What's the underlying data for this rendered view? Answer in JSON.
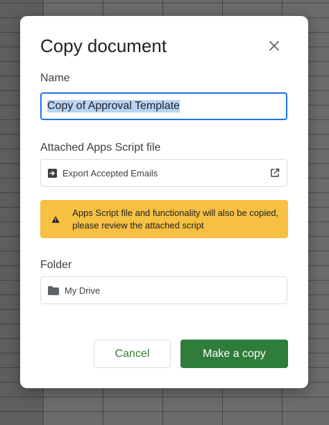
{
  "dialog": {
    "title": "Copy document",
    "close_icon": "close-icon",
    "name_label": "Name",
    "name_value": "Copy of Approval Template",
    "script_label": "Attached Apps Script file",
    "script_file": "Export Accepted Emails",
    "script_file_icon": "script-arrow-icon",
    "open_icon": "open-in-new-icon",
    "warning_text": "Apps Script file and functionality will also be copied, please review the attached script",
    "warning_icon": "warning-triangle-icon",
    "folder_label": "Folder",
    "folder_value": "My Drive",
    "folder_icon": "folder-icon",
    "cancel_label": "Cancel",
    "copy_label": "Make a copy"
  },
  "colors": {
    "accent_blue": "#1a73e8",
    "selection": "#b9d3f4",
    "warning_bg": "#f6c042",
    "primary_green": "#2e7d3a",
    "cancel_text": "#2e7d32"
  }
}
